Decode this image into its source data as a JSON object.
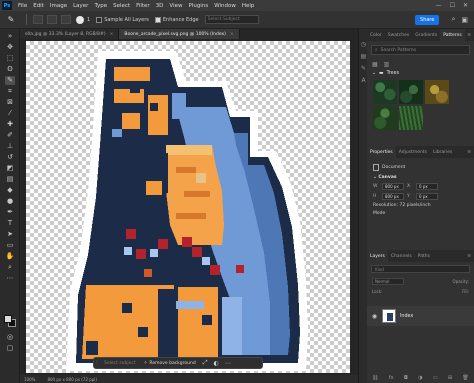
{
  "menu": {
    "logo": "Ps",
    "items": [
      "File",
      "Edit",
      "Image",
      "Layer",
      "Type",
      "Select",
      "Filter",
      "3D",
      "View",
      "Plugins",
      "Window",
      "Help"
    ],
    "window_controls": [
      "—",
      "☐",
      "✕"
    ]
  },
  "options": {
    "tool_icon": "brush-icon",
    "brush_size": "1",
    "sample_all_layers": "Sample All Layers",
    "enhance_edge": "Enhance Edge",
    "select_subject_placeholder": "Select Subject",
    "share": "Share"
  },
  "tabs": [
    {
      "label": "ella.jpg @ 33.3% (Layer 8, RGB/8#)",
      "active": false
    },
    {
      "label": "Boone_arcade_pixel.svg.png @ 100% (Index)",
      "active": true
    }
  ],
  "taskbar": {
    "select_subject": "Select subject",
    "remove_background": "Remove background"
  },
  "status": {
    "zoom": "100%",
    "doc_info": "800 px x 800 px (72 ppi)"
  },
  "panel_top": {
    "tabs": [
      "Color",
      "Swatches",
      "Gradients",
      "Patterns"
    ],
    "active_tab": "Patterns",
    "search_placeholder": "Search Patterns",
    "group_name": "Trees"
  },
  "properties": {
    "tabs": [
      "Properties",
      "Adjustments",
      "Libraries"
    ],
    "doc_label": "Document",
    "section": "Canvas",
    "w_label": "W",
    "w_value": "800 px",
    "h_label": "H",
    "h_value": "800 px",
    "x_label": "X",
    "x_value": "0 px",
    "y_label": "Y",
    "y_value": "0 px",
    "resolution": "Resolution: 72 pixels/inch",
    "mode": "Mode"
  },
  "layers": {
    "tabs": [
      "Layers",
      "Channels",
      "Paths"
    ],
    "search_placeholder": "Kind",
    "blend_mode": "Normal",
    "opacity_label": "Opacity:",
    "lock_label": "Lock:",
    "fill_label": "Fill:",
    "layer_name": "Index"
  }
}
